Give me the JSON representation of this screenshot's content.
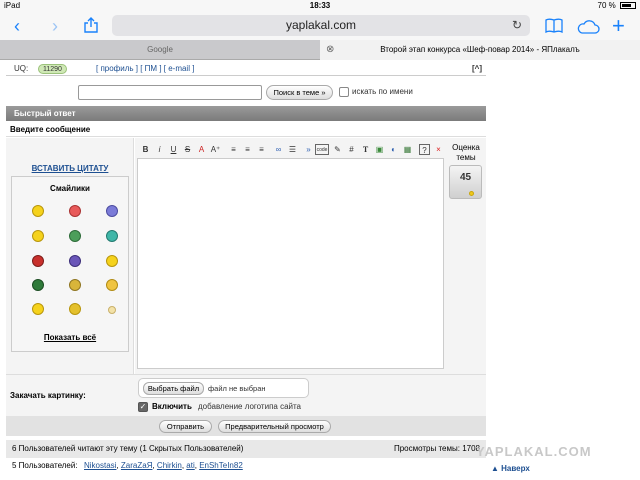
{
  "status_bar": {
    "device": "iPad",
    "time": "18:33",
    "battery": "70 %"
  },
  "browser": {
    "url": "yaplakal.com",
    "tabs": [
      {
        "label": "Google"
      },
      {
        "label": "Второй этап конкурса «Шеф-повар 2014» - ЯПлакалъ"
      }
    ]
  },
  "userbar": {
    "uq_label": "UQ:",
    "uq_value": "11290",
    "links": "[ профиль ] [ ПМ ] [ e-mail ]",
    "top_link": "[^]"
  },
  "search": {
    "button": "Поиск в теме »",
    "by_name": "искать по имени"
  },
  "quick_reply": {
    "title": "Быстрый ответ",
    "prompt": "Введите сообщение"
  },
  "sidebar": {
    "insert_quote": "ВСТАВИТЬ ЦИТАТУ",
    "smilies_title": "Смайлики",
    "show_all": "Показать всё"
  },
  "rating": {
    "label": "Оценка темы",
    "value": "45"
  },
  "upload": {
    "label": "Закачать картинку:",
    "choose_file": "Выбрать файл",
    "file_status": "файл не выбран",
    "logo_bold": "Включить",
    "logo_text": "добавление логотипа сайта"
  },
  "actions": {
    "send": "Отправить",
    "preview": "Предварительный просмотр"
  },
  "readers": {
    "text": "6 Пользователей читают эту тему (1 Скрытых Пользователей)",
    "views": "Просмотры темы: 1708"
  },
  "users": {
    "prefix": "5 Пользователей:",
    "names": [
      "Nikostasi",
      "ZaraZaЯ",
      "Chirkin",
      "ati",
      "EnShTeIn82"
    ]
  },
  "watermark": "YAPLAKAL.COM",
  "back_to_top": "▲ Наверх"
}
